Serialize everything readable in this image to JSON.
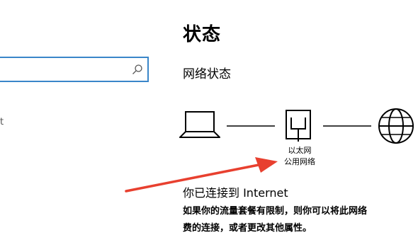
{
  "search": {
    "value": ""
  },
  "nav": {
    "partial_label": "t"
  },
  "page": {
    "title": "状态",
    "section_title": "网络状态"
  },
  "network": {
    "adapter_name": "以太网",
    "network_type": "公用网络",
    "connected_message": "你已连接到 Internet",
    "description_line1": "如果你的流量套餐有限制，则你可以将此网络",
    "description_line2": "费的连接，或者更改其他属性。"
  },
  "colors": {
    "accent": "#3a86c9",
    "annotation_arrow": "#e8402f"
  }
}
